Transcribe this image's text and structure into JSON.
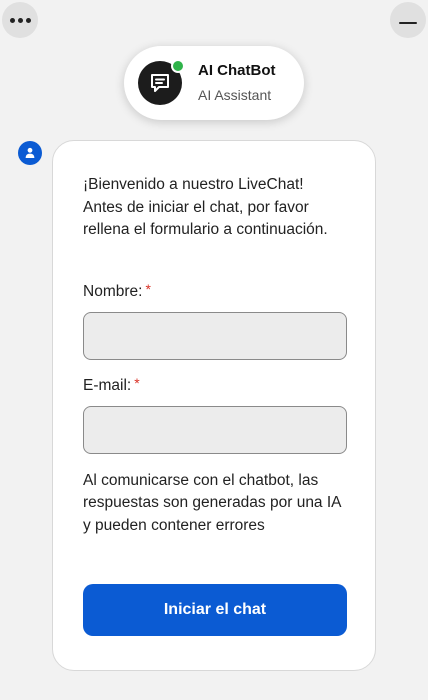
{
  "controls": {
    "menu_icon": "more-horizontal-icon",
    "minimize_icon": "minimize-icon"
  },
  "header": {
    "bot_name": "AI ChatBot",
    "bot_subtitle": "AI Assistant",
    "avatar_icon": "chat-bubble-icon",
    "status": "online",
    "status_color": "#2fb34a"
  },
  "message": {
    "sender_icon": "user-icon",
    "welcome_text": "¡Bienvenido a nuestro LiveChat! Antes de iniciar el chat, por favor rellena el formulario a continuación."
  },
  "form": {
    "name_label": "Nombre:",
    "name_value": "",
    "email_label": "E-mail:",
    "email_value": "",
    "required_marker": "*",
    "disclaimer": "Al comunicarse con el chatbot, las respuestas son generadas por una IA y pueden contener errores",
    "submit_label": "Iniciar el chat"
  },
  "colors": {
    "accent": "#0b5bd3",
    "required": "#d93025",
    "background": "#f2f2f2"
  }
}
